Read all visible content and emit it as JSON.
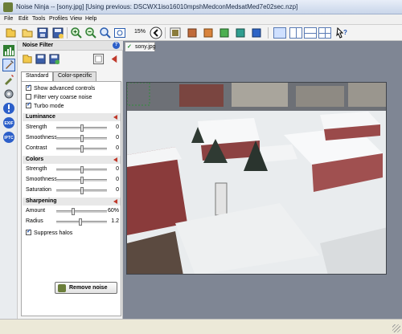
{
  "window": {
    "title": "Noise Ninja -- [sony.jpg] [Using previous: DSCWX1iso16010mpshMedconMedsatMed7e02sec.nzp]"
  },
  "menu": [
    "File",
    "Edit",
    "Tools",
    "Profiles",
    "View",
    "Help"
  ],
  "toolbar": {
    "zoom": "15%",
    "icons": [
      "new-file-icon",
      "open-folder-icon",
      "save-icon",
      "save-as-icon",
      "zoom-in-icon",
      "zoom-out-icon",
      "zoom-fit-icon",
      "actual-size-icon",
      "back-arrow-icon",
      "color-swatch-icon",
      "layout-single-icon",
      "layout-split-vertical-icon",
      "layout-split-horizontal-icon",
      "layout-quad-icon",
      "help-cursor-icon"
    ]
  },
  "panel": {
    "title": "Noise Filter",
    "help_label": "?",
    "tabs": [
      "Standard",
      "Color-specific"
    ],
    "options": [
      {
        "label": "Show advanced controls",
        "checked": true
      },
      {
        "label": "Filter very coarse noise",
        "checked": false
      },
      {
        "label": "Turbo mode",
        "checked": true
      }
    ],
    "sections": {
      "luminance": {
        "title": "Luminance",
        "sliders": [
          {
            "label": "Strength",
            "value": "0",
            "level": 0.5
          },
          {
            "label": "Smoothness",
            "value": "0",
            "level": 0.5
          },
          {
            "label": "Contrast",
            "value": "0",
            "level": 0.5
          }
        ]
      },
      "colors": {
        "title": "Colors",
        "sliders": [
          {
            "label": "Strength",
            "value": "0",
            "level": 0.5
          },
          {
            "label": "Smoothness",
            "value": "0",
            "level": 0.5
          },
          {
            "label": "Saturation",
            "value": "0",
            "level": 0.5
          }
        ]
      },
      "sharpening": {
        "title": "Sharpening",
        "sliders": [
          {
            "label": "Amount",
            "value": "60%",
            "level": 0.32
          },
          {
            "label": "Radius",
            "value": "1.2",
            "level": 0.48
          }
        ],
        "suppress_halos": {
          "label": "Suppress halos",
          "checked": true
        }
      }
    },
    "remove_button": "Remove noise"
  },
  "image_tab": {
    "filename": "sony.jpg",
    "status_icon": "check-icon"
  },
  "left_icons": [
    "histogram-icon",
    "noise-filter-icon",
    "brush-icon",
    "profile-gear-icon",
    "info-icon",
    "exif-icon",
    "iptc-icon"
  ],
  "left_icon_labels": {
    "exif": "EXIF",
    "iptc": "IPTC"
  }
}
